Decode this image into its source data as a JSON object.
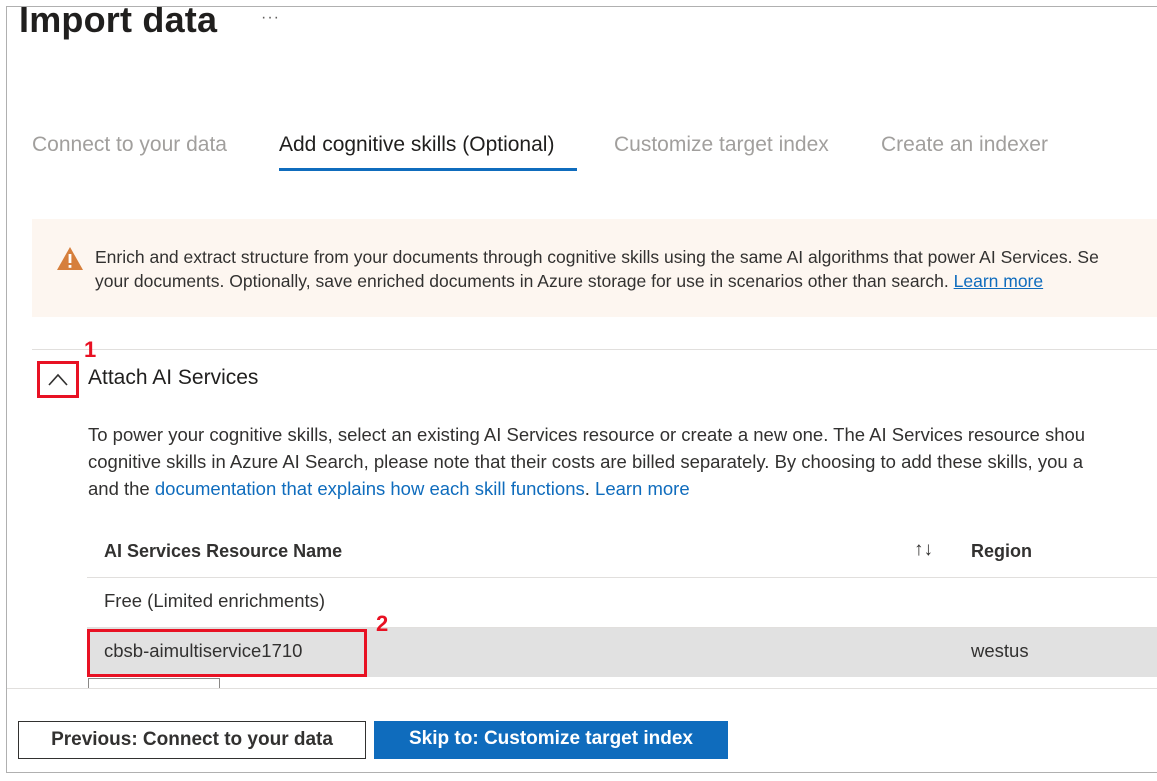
{
  "page": {
    "title": "Import data",
    "more_label": "···"
  },
  "tabs": [
    {
      "label": "Connect to your data"
    },
    {
      "label": "Add cognitive skills (Optional)"
    },
    {
      "label": "Customize target index"
    },
    {
      "label": "Create an indexer"
    }
  ],
  "banner": {
    "line1": "Enrich and extract structure from your documents through cognitive skills using the same AI algorithms that power AI Services. Se",
    "line2": "your documents. Optionally, save enriched documents in Azure storage for use in scenarios other than search. ",
    "learn_more": "Learn more"
  },
  "annotations": {
    "one": "1",
    "two": "2"
  },
  "section": {
    "title": "Attach AI Services",
    "desc_line1": "To power your cognitive skills, select an existing AI Services resource or create a new one. The AI Services resource shou",
    "desc_line2": "cognitive skills in Azure AI Search, please note that their costs are billed separately. By choosing to add these skills, you a",
    "desc_line3_prefix": "and the ",
    "desc_link": "documentation that explains how each skill functions",
    "desc_sep": ". ",
    "learn_more": "Learn more"
  },
  "table": {
    "headers": {
      "name": "AI Services Resource Name",
      "sort": "↑↓",
      "region": "Region"
    },
    "rows": [
      {
        "name": "Free (Limited enrichments)",
        "region": ""
      },
      {
        "name": "cbsb-aimultiservice1710",
        "region": "westus"
      }
    ]
  },
  "footer": {
    "previous": "Previous: Connect to your data",
    "skip": "Skip to: Customize target index"
  },
  "colors": {
    "accent": "#0f6cbd",
    "annotation": "#e81123",
    "warning": "#d67f3c"
  },
  "icons": {
    "warning": "warning-icon",
    "collapse": "chevron-up-icon",
    "sort": "sort-icon"
  }
}
